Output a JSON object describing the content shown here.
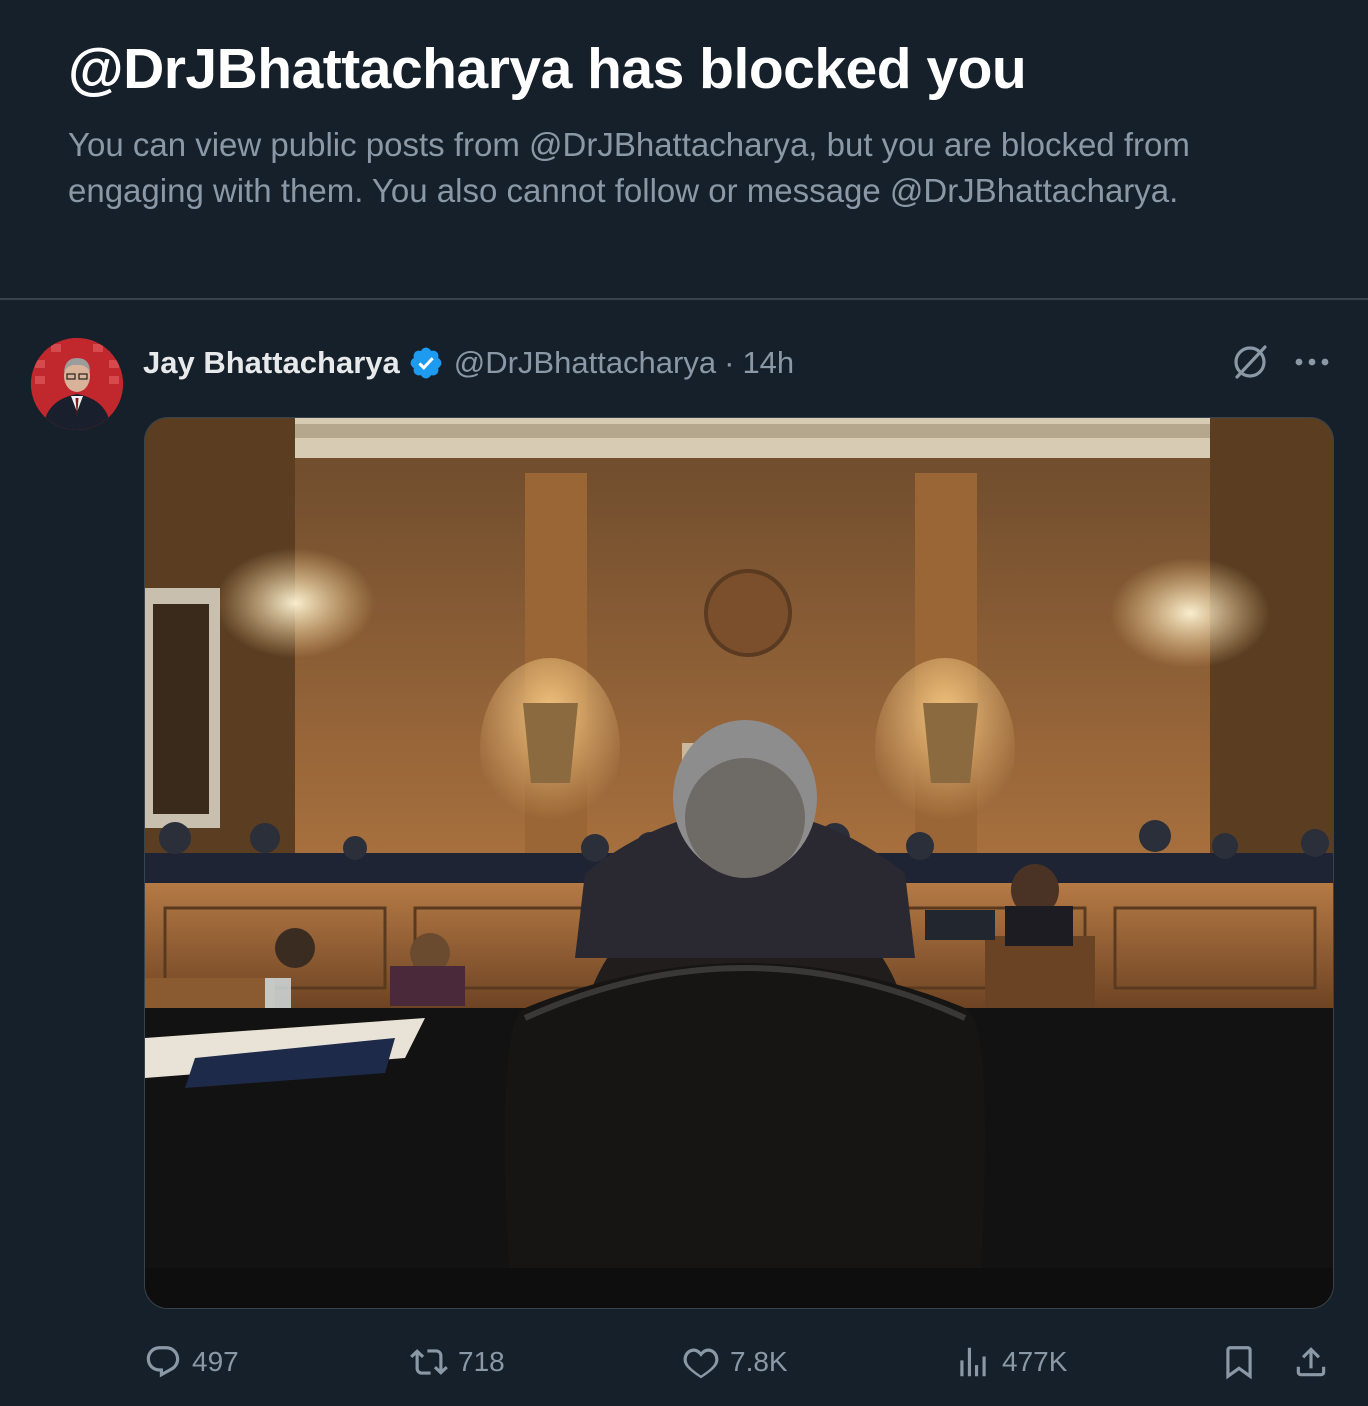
{
  "blocked": {
    "title": "@DrJBhattacharya has blocked you",
    "description": "You can view public posts from @DrJBhattacharya, but you are blocked from engaging with them. You also cannot follow or message @DrJBhattacharya."
  },
  "post": {
    "author_name": "Jay Bhattacharya",
    "handle": "@DrJBhattacharya",
    "separator": "·",
    "timestamp": "14h",
    "verified": true,
    "image_alt": "Senate committee hearing room viewed from behind a seated witness",
    "stats": {
      "replies": "497",
      "reposts": "718",
      "likes": "7.8K",
      "views": "477K"
    }
  },
  "colors": {
    "background": "#15202b",
    "text_secondary": "#8b98a5",
    "verified_blue": "#1d9bf0",
    "divider": "#38444d"
  },
  "icons": [
    "verified-badge-icon",
    "grok-icon",
    "more-icon",
    "reply-icon",
    "repost-icon",
    "like-icon",
    "views-icon",
    "bookmark-icon",
    "share-icon"
  ]
}
